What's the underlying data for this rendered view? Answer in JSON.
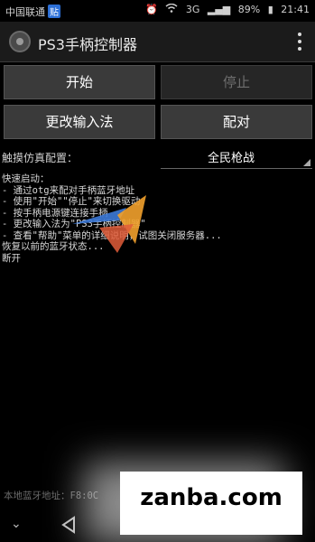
{
  "status_bar": {
    "carrier": "中国联通",
    "badge": "贴",
    "network": "3G",
    "battery": "89%",
    "time": "21:41"
  },
  "app_bar": {
    "title": "PS3手柄控制器"
  },
  "buttons": {
    "start": "开始",
    "stop": "停止",
    "change_input": "更改输入法",
    "pair": "配对"
  },
  "touch_config": {
    "label": "触摸仿真配置：",
    "value": "全民枪战"
  },
  "log": {
    "lines": [
      "快速启动：",
      "- 通过otg来配对手柄蓝牙地址",
      "- 使用\"开始\"\"停止\"来切换驱动",
      "- 按手柄电源键连接手柄",
      "- 更改输入法为\"PS3手柄控制器\"",
      "- 查看\"帮助\"菜单的详细说明，试图关闭服务器...",
      "恢复以前的蓝牙状态...",
      "断开"
    ]
  },
  "footer": {
    "local_address": "本地蓝牙地址：F8:0C"
  },
  "overlay": {
    "watermark_brand": "zanba.com"
  },
  "colors": {
    "background": "#000000",
    "button": "#3a3a3a",
    "button_disabled_text": "#6f6f6f"
  }
}
